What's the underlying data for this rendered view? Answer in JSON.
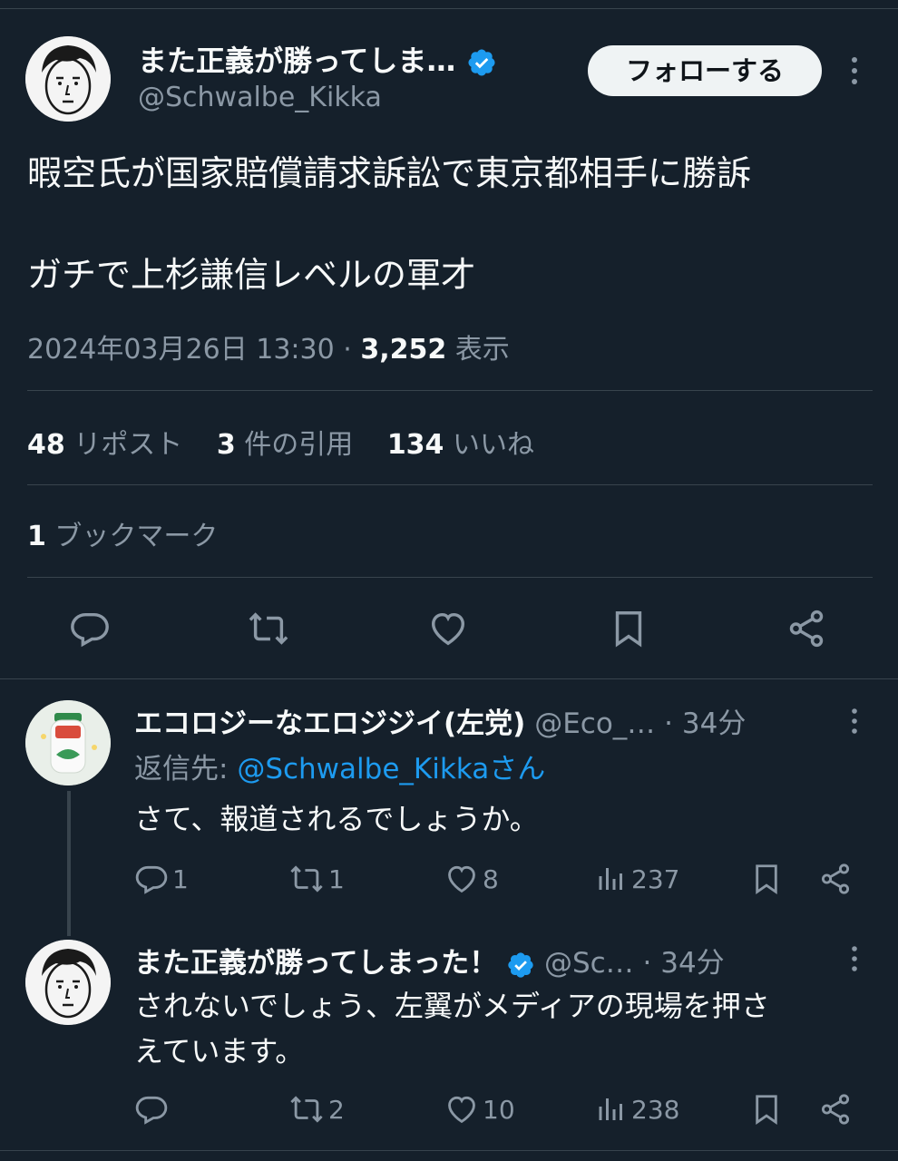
{
  "main_tweet": {
    "display_name": "また正義が勝ってしま…",
    "handle": "@Schwalbe_Kikka",
    "follow_label": "フォローする",
    "text_line1": "暇空氏が国家賠償請求訴訟で東京都相手に勝訴",
    "text_line2": "ガチで上杉謙信レベルの軍才",
    "timestamp": "2024年03月26日 13:30",
    "separator": "·",
    "views_count": "3,252",
    "views_label": "表示",
    "stats": {
      "reposts_count": "48",
      "reposts_label": "リポスト",
      "quotes_count": "3",
      "quotes_label": "件の引用",
      "likes_count": "134",
      "likes_label": "いいね",
      "bookmarks_count": "1",
      "bookmarks_label": "ブックマーク"
    }
  },
  "reply1": {
    "display_name": "エコロジーなエロジジイ(左党)",
    "handle": "@Eco_…",
    "time": "· 34分",
    "reply_to_label": "返信先:",
    "reply_to_handle": "@Schwalbe_Kikkaさん",
    "text": "さて、報道されるでしょうか。",
    "replies": "1",
    "reposts": "1",
    "likes": "8",
    "views": "237"
  },
  "reply2": {
    "display_name": "また正義が勝ってしまった！",
    "handle": "@Sc…",
    "time": "· 34分",
    "text_line1": "されないでしょう、左翼がメディアの現場を押さ",
    "text_line2": "えています。",
    "replies": "",
    "reposts": "2",
    "likes": "10",
    "views": "238"
  },
  "colors": {
    "background": "#15202b",
    "text": "#f7f9f9",
    "muted": "#8b98a5",
    "link": "#1d9bf0",
    "verified": "#1d9bf0",
    "divider": "#38444d"
  }
}
